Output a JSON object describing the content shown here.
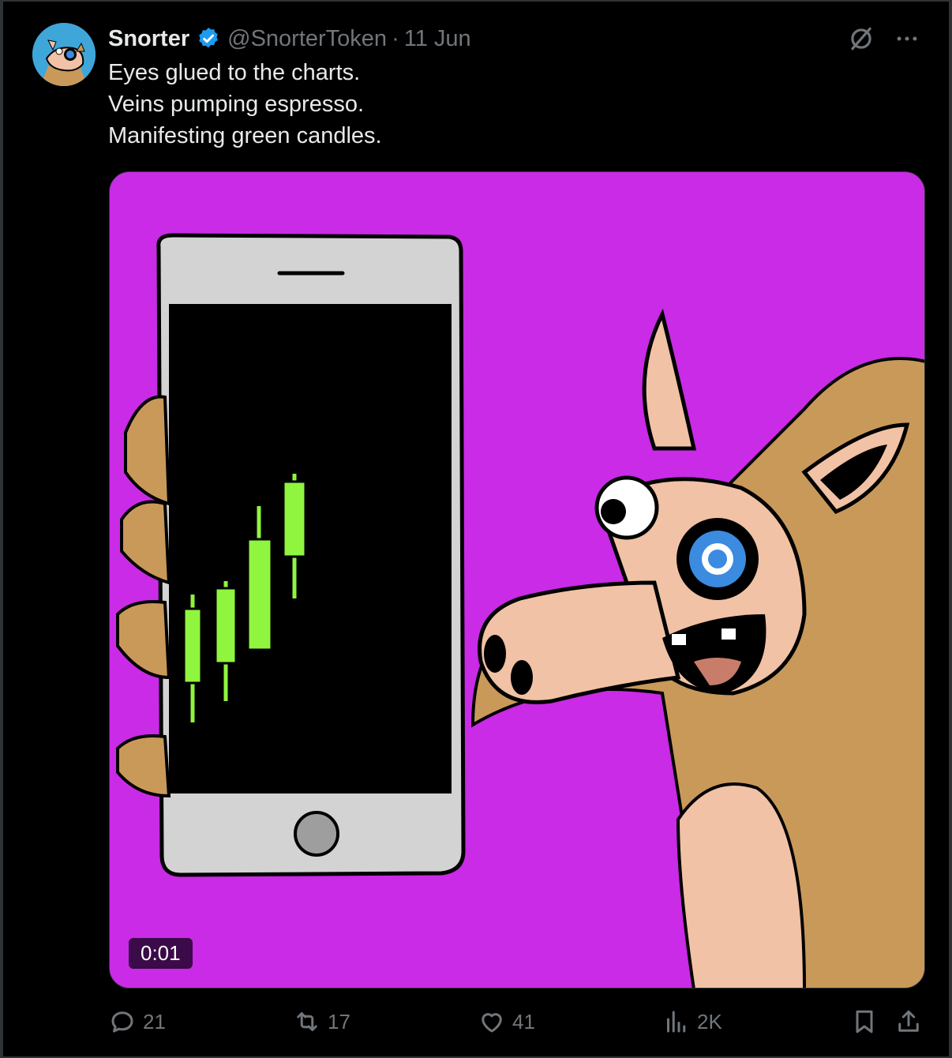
{
  "author": {
    "name": "Snorter",
    "handle": "@SnorterToken",
    "separator": "·",
    "date": "11 Jun",
    "verified": true
  },
  "icons": {
    "verified": "verified-badge-icon",
    "grok": "grok-icon",
    "more": "more-icon",
    "reply": "reply-icon",
    "retweet": "retweet-icon",
    "like": "like-icon",
    "views": "views-icon",
    "bookmark": "bookmark-icon",
    "share": "share-icon"
  },
  "tweet": {
    "lines": [
      "Eyes glued to the charts.",
      "Veins pumping espresso.",
      "Manifesting green candles."
    ]
  },
  "media": {
    "timecode": "0:01",
    "background_color": "#c92be6"
  },
  "actions": {
    "replies": "21",
    "retweets": "17",
    "likes": "41",
    "views": "2K"
  },
  "colors": {
    "verified": "#1d9bf0",
    "muted": "#71767b",
    "text": "#e7e9ea",
    "candle": "#8ff53f"
  }
}
